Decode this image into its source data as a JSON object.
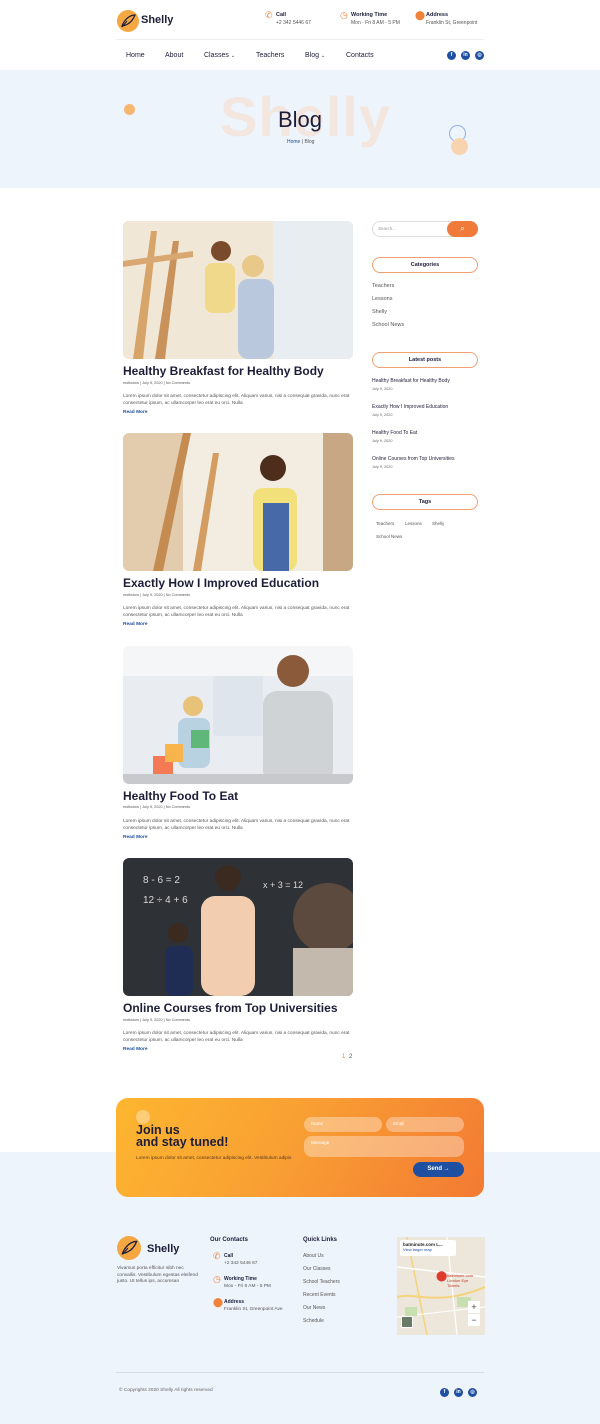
{
  "header": {
    "logo": "Shelly",
    "call": {
      "title": "Call",
      "value": "+2 342 5446 67",
      "icon": "phone-icon"
    },
    "hours": {
      "title": "Working Time",
      "value": "Mon - Fri 8 AM - 5 PM",
      "icon": "clock-icon"
    },
    "address": {
      "title": "Address",
      "value": "Franklin St, Greenpoint",
      "icon": "map-pin-icon"
    },
    "nav": [
      "Home",
      "About",
      "Classes",
      "Teachers",
      "Blog",
      "Contacts"
    ],
    "social": [
      "f",
      "in",
      "◎"
    ]
  },
  "banner": {
    "bg_text": "Shelly",
    "title": "Blog",
    "crumb_home": "Home",
    "crumb_sep": "|",
    "crumb_current": "Blog"
  },
  "posts": [
    {
      "title": "Healthy Breakfast for Healthy Body",
      "meta": "motkulow  |  July 9, 2020  |  No Comments",
      "excerpt": "Lorem ipsum dolor sit amet, consectetur adipiscing elit. Aliquam varius, nisi a consequat gravida, nunc erat consectetur ipsum, ac ullamcorper leo erat eu orci. Nulla",
      "read_more": "Read More"
    },
    {
      "title": "Exactly How I Improved Education",
      "meta": "motkulow  |  July 9, 2020  |  No Comments",
      "excerpt": "Lorem ipsum dolor sit amet, consectetur adipiscing elit. Aliquam varius, nisi a consequat gravida, nunc erat consectetur ipsum, ac ullamcorper leo erat eu orci. Nulla",
      "read_more": "Read More"
    },
    {
      "title": "Healthy Food To Eat",
      "meta": "motkulow  |  July 9, 2020  |  No Comments",
      "excerpt": "Lorem ipsum dolor sit amet, consectetur adipiscing elit. Aliquam varius, nisi a consequat gravida, nunc erat consectetur ipsum, ac ullamcorper leo erat eu orci. Nulla",
      "read_more": "Read More"
    },
    {
      "title": "Online Courses from Top Universities",
      "meta": "motkulow  |  July 9, 2020  |  No Comments",
      "excerpt": "Lorem ipsum dolor sit amet, consectetur adipiscing elit. Aliquam varius, nisi a consequat gravida, nunc erat consectetur ipsum, ac ullamcorper leo erat eu orci. Nulla",
      "read_more": "Read More"
    }
  ],
  "pagination": [
    "1",
    "2"
  ],
  "sidebar": {
    "search_placeholder": "Search...",
    "categories_title": "Categories",
    "categories": [
      "Teachers",
      "Lessons",
      "Shelly",
      "School News"
    ],
    "latest_title": "Latest posts",
    "latest": [
      {
        "title": "Healthy Breakfast for Healthy Body",
        "date": "July 9, 2020"
      },
      {
        "title": "Exactly How I Improved Education",
        "date": "July 9, 2020"
      },
      {
        "title": "Healthy Food To Eat",
        "date": "July 9, 2020"
      },
      {
        "title": "Online Courses from Top Universities",
        "date": "July 9, 2020"
      }
    ],
    "tags_title": "Tags",
    "tags": [
      "Teachers",
      "Lessons",
      "Shelly",
      "School News"
    ]
  },
  "cta": {
    "title_line1": "Join us",
    "title_line2": "and stay tuned!",
    "text": "Lorem ipsum dolor sit amet, consectetur adipiscing elit. Vestibulum adipis",
    "name_placeholder": "Name",
    "email_placeholder": "Email",
    "message_placeholder": "Message",
    "send": "Send"
  },
  "footer": {
    "logo": "Shelly",
    "about": "Vivamus porta efficitur nibh nec convallis. Vestibulum egestas eleifend justo. Ut tellus ips, accumsan",
    "contacts_title": "Our Contacts",
    "call_title": "Call",
    "call_value": "+2 342 5446 67",
    "hours_title": "Working Time",
    "hours_value": "Mon - Fri 8 AM - 5 PM",
    "address_title": "Address",
    "address_value": "Franklin St, Greenpoint Ave",
    "links_title": "Quick Links",
    "links": [
      "About Us",
      "Our Classes",
      "School Teachers",
      "Recent Events",
      "Our News",
      "Schedule"
    ],
    "map_title": "batminute.com L...",
    "map_link": "View larger map",
    "map_pin": "batminute.com London Eye Tickets",
    "map_zoom_in": "+",
    "map_zoom_out": "−",
    "copyright": "© Copyrights 2020 Shelly All rights reserved",
    "social": [
      "f",
      "in",
      "◎"
    ]
  },
  "colors": {
    "accent": "#f07a3a",
    "brand_blue": "#1e4fa0",
    "dark": "#1d1d3a",
    "banner_bg": "#eef4fc"
  }
}
